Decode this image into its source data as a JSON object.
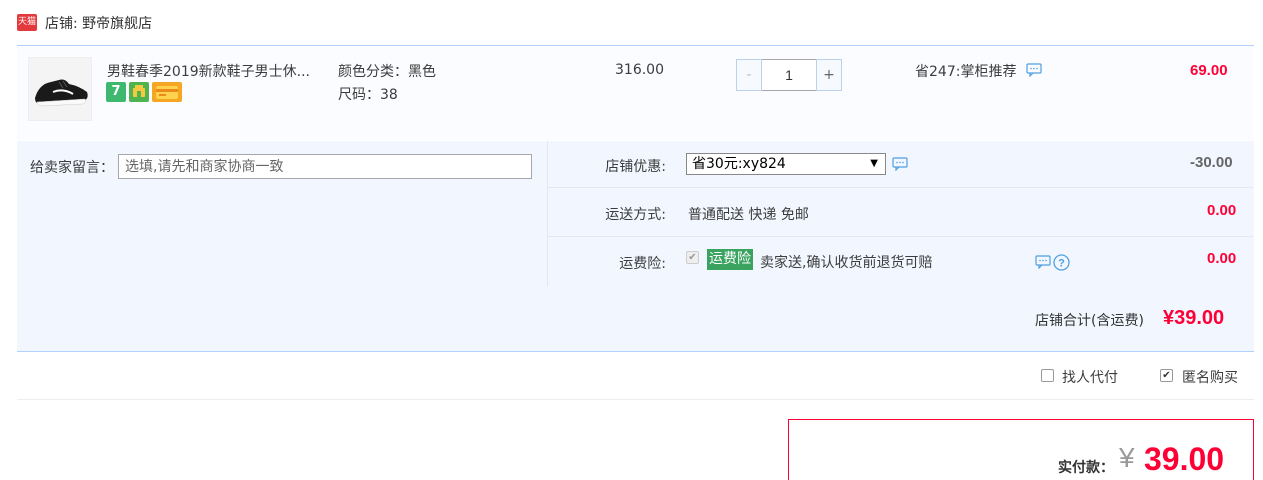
{
  "shop": {
    "logo_text": "天猫",
    "label": "店铺: 野帝旗舰店"
  },
  "item": {
    "title": "男鞋春季2019新款鞋子男士休...",
    "badge1": "7",
    "color_label": "颜色分类：黑色",
    "size_label": "尺码：38",
    "price": "316.00",
    "qty_minus": "-",
    "qty_value": "1",
    "qty_plus": "+",
    "save_text": "省247:掌柜推荐",
    "sum": "69.00"
  },
  "memo": {
    "label": "给卖家留言：",
    "placeholder": "选填,请先和商家协商一致"
  },
  "options": {
    "coupon_label": "店铺优惠:",
    "coupon_selected": "省30元:xy824",
    "coupon_amount": "-30.00",
    "shipping_label": "运送方式:",
    "shipping_value": "普通配送 快递 免邮",
    "shipping_amount": "0.00",
    "insurance_label": "运费险:",
    "insurance_tag": "运费险",
    "insurance_text": "卖家送,确认收货前退货可赔",
    "insurance_amount": "0.00"
  },
  "shop_total": {
    "label": "店铺合计(含运费)",
    "value": "¥39.00"
  },
  "pay_options": {
    "proxy_label": "找人代付",
    "anon_label": "匿名购买"
  },
  "payment": {
    "label": "实付款：",
    "currency": "¥",
    "value": "39.00"
  },
  "colors": {
    "accent_red": "#ff0036",
    "light_blue_bg": "#f2f7ff",
    "tag_green": "#3aa35f"
  }
}
